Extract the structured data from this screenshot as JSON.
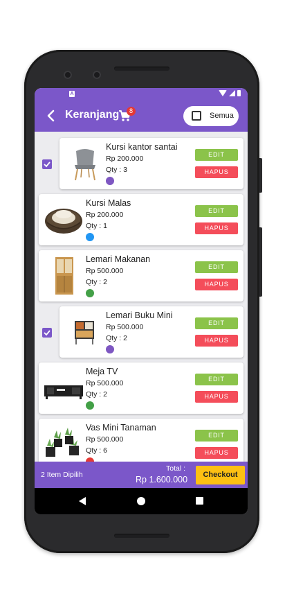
{
  "app": {
    "title": "Keranjang",
    "cart_badge": "8",
    "select_all_label": "Semua"
  },
  "items": [
    {
      "name": "Kursi kantor santai",
      "price": "Rp 200.000",
      "qty": "Qty : 3",
      "dot_color": "#7e57c2",
      "selected": true
    },
    {
      "name": "Kursi Malas",
      "price": "Rp 200.000",
      "qty": "Qty : 1",
      "dot_color": "#2196f3",
      "selected": false
    },
    {
      "name": "Lemari Makanan",
      "price": "Rp 500.000",
      "qty": "Qty : 2",
      "dot_color": "#43a047",
      "selected": false
    },
    {
      "name": "Lemari Buku Mini",
      "price": "Rp 500.000",
      "qty": "Qty : 2",
      "dot_color": "#7e57c2",
      "selected": true
    },
    {
      "name": "Meja TV",
      "price": "Rp 500.000",
      "qty": "Qty : 2",
      "dot_color": "#43a047",
      "selected": false
    },
    {
      "name": "Vas Mini Tanaman",
      "price": "Rp 500.000",
      "qty": "Qty : 6",
      "dot_color": "#e53935",
      "selected": false
    }
  ],
  "buttons": {
    "edit": "EDIT",
    "delete": "HAPUS",
    "checkout": "Checkout"
  },
  "footer": {
    "selected_count": "2 Item Dipilih",
    "total_label": "Total :",
    "total_value": "Rp 1.600.000"
  },
  "colors": {
    "primary": "#7b57c9",
    "edit": "#8bc34a",
    "delete": "#f44d5a",
    "checkout": "#fdc013"
  }
}
